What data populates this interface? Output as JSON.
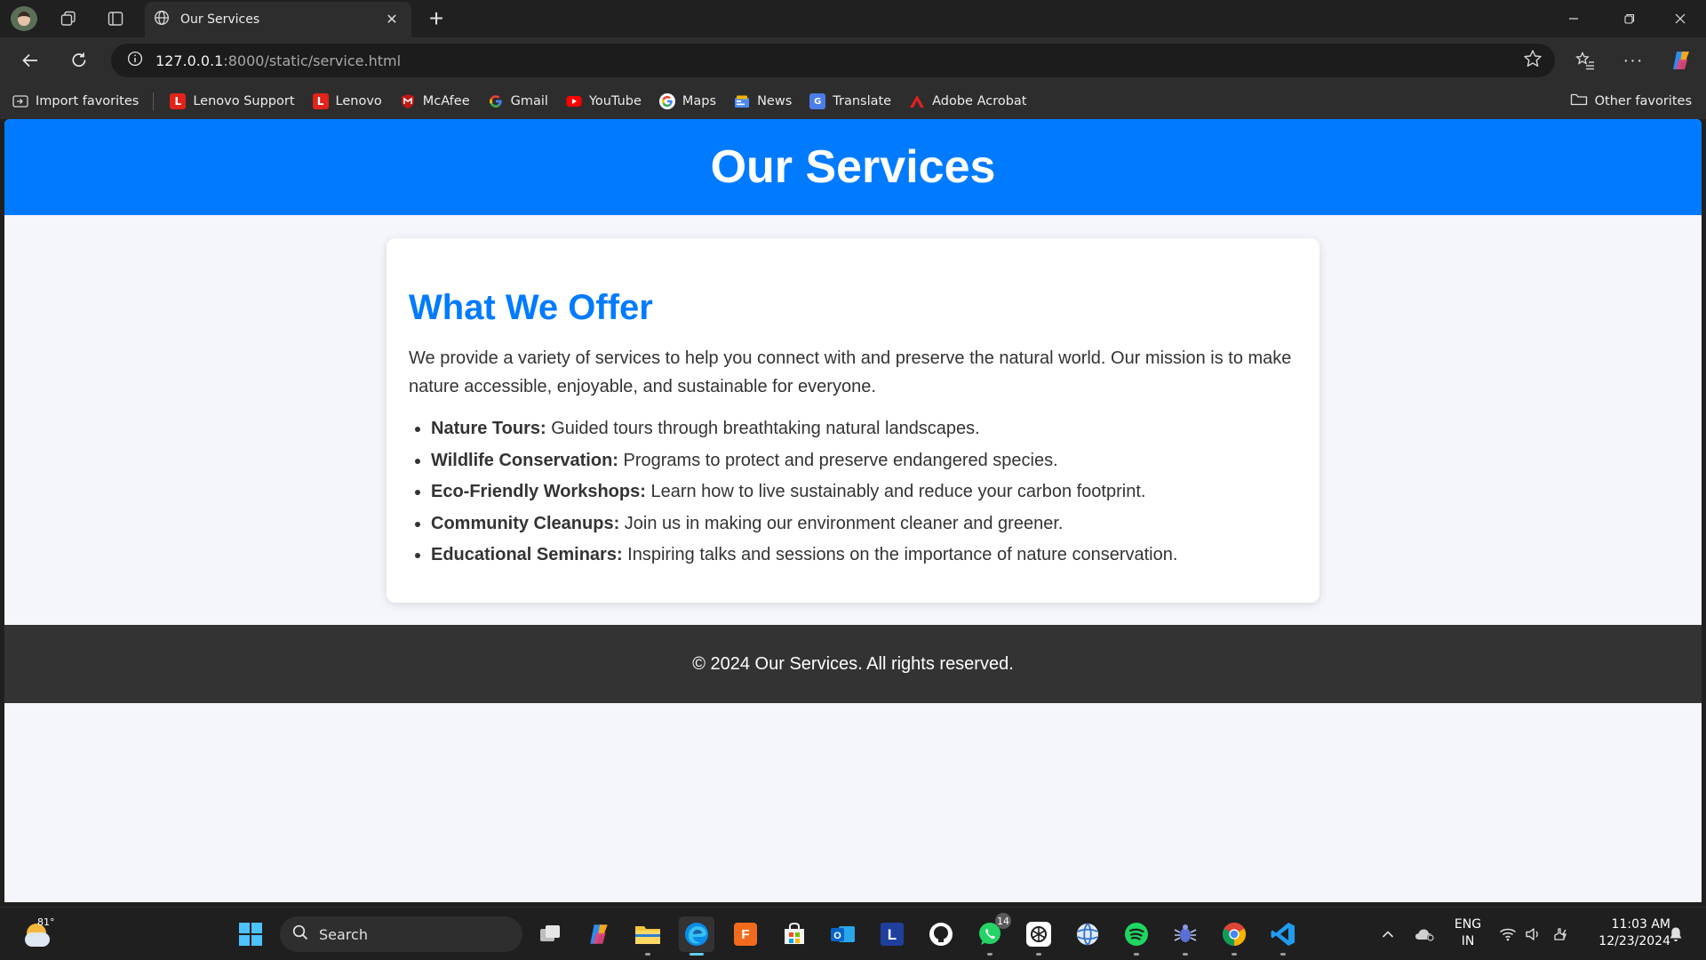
{
  "browser": {
    "tab_title": "Our Services",
    "url_host": "127.0.0.1",
    "url_path": ":8000/static/service.html",
    "favorites": [
      {
        "label": "Import favorites",
        "icon": "import-icon",
        "color": "#cccccc"
      },
      {
        "label": "Lenovo Support",
        "icon": "lenovo-icon",
        "color": "#e2231a"
      },
      {
        "label": "Lenovo",
        "icon": "lenovo-icon",
        "color": "#e2231a"
      },
      {
        "label": "McAfee",
        "icon": "mcafee-icon",
        "color": "#c01818"
      },
      {
        "label": "Gmail",
        "icon": "google-icon",
        "color": "#4285f4"
      },
      {
        "label": "YouTube",
        "icon": "youtube-icon",
        "color": "#ff0000"
      },
      {
        "label": "Maps",
        "icon": "google-icon",
        "color": "#4285f4"
      },
      {
        "label": "News",
        "icon": "news-icon",
        "color": "#4c8bf5"
      },
      {
        "label": "Translate",
        "icon": "translate-icon",
        "color": "#4a7de8"
      },
      {
        "label": "Adobe Acrobat",
        "icon": "acrobat-icon",
        "color": "#e21f1f"
      }
    ],
    "other_favorites": "Other favorites"
  },
  "page": {
    "header_title": "Our Services",
    "section_title": "What We Offer",
    "intro": "We provide a variety of services to help you connect with and preserve the natural world. Our mission is to make nature accessible, enjoyable, and sustainable for everyone.",
    "services": [
      {
        "name": "Nature Tours:",
        "desc": " Guided tours through breathtaking natural landscapes."
      },
      {
        "name": "Wildlife Conservation:",
        "desc": " Programs to protect and preserve endangered species."
      },
      {
        "name": "Eco-Friendly Workshops:",
        "desc": " Learn how to live sustainably and reduce your carbon footprint."
      },
      {
        "name": "Community Cleanups:",
        "desc": " Join us in making our environment cleaner and greener."
      },
      {
        "name": "Educational Seminars:",
        "desc": " Inspiring talks and sessions on the importance of nature conservation."
      }
    ],
    "footer": "© 2024 Our Services. All rights reserved.",
    "accent_color": "#007bff",
    "footer_color": "#333333"
  },
  "taskbar": {
    "weather_temp": "81°",
    "search_placeholder": "Search",
    "whatsapp_badge": "14",
    "lang_line1": "ENG",
    "lang_line2": "IN",
    "time": "11:03 AM",
    "date": "12/23/2024"
  }
}
